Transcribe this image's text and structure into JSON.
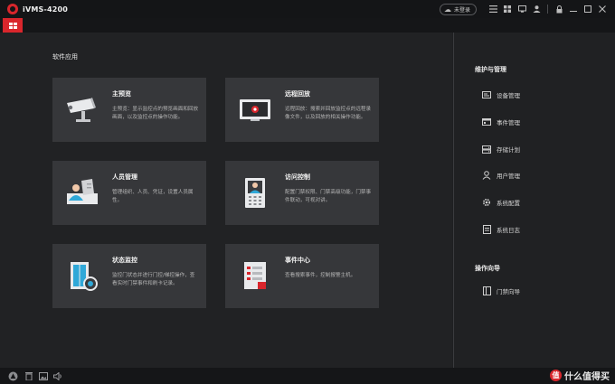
{
  "app": {
    "title": "iVMS-4200"
  },
  "titlebar": {
    "login_label": "未登录",
    "icons": [
      "cloud-icon",
      "list-icon",
      "grid-icon",
      "monitor-icon",
      "user-icon",
      "lock-icon",
      "minimize-icon",
      "maximize-icon",
      "close-icon"
    ]
  },
  "main": {
    "section_title": "软件应用",
    "cards": [
      {
        "title": "主预览",
        "desc": "主预览：显示监控点的预览画面和回放画面，以及监控点的操作功能。"
      },
      {
        "title": "远程回放",
        "desc": "远程回放：搜索并回放监控点的远程录像文件，以及回放的相关操作功能。"
      },
      {
        "title": "人员管理",
        "desc": "管理组织、人员、凭证，设置人员属性。"
      },
      {
        "title": "访问控制",
        "desc": "配置门禁权限、门禁高级功能，门禁事件联动，可视对讲。"
      },
      {
        "title": "状态监控",
        "desc": "监控门状态并进行门控/梯控操作，查看实时门禁事件和刷卡记录。"
      },
      {
        "title": "事件中心",
        "desc": "查看搜索事件，控制报警主机。"
      }
    ]
  },
  "side": {
    "maint_title": "维护与管理",
    "maint_items": [
      "设备管理",
      "事件管理",
      "存储计划",
      "用户管理",
      "系统配置",
      "系统日志"
    ],
    "guide_title": "操作向导",
    "guide_items": [
      "门禁向导"
    ]
  },
  "status": {
    "watermark": "什么值得买"
  },
  "colors": {
    "accent": "#d9262c",
    "card": "#36373a",
    "bg": "#212224"
  }
}
